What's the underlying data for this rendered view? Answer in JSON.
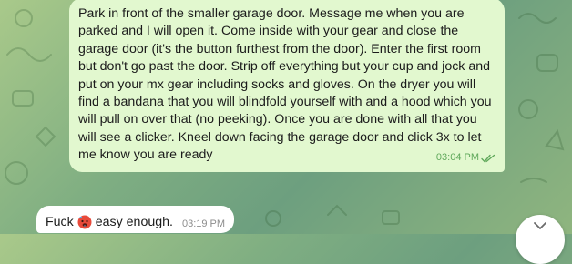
{
  "chat": {
    "outgoing": {
      "text": "Park in front of the smaller garage door.  Message me when you are parked and I will open it.  Come inside with your gear and close the garage door (it's the button furthest from the door).  Enter the first room but don't go past the door.  Strip off everything but your cup and jock and put on your mx gear including socks and gloves.  On the dryer you will find a bandana that you will blindfold yourself with and a hood which you will pull on over that (no peeking).  Once you are done with all that you will see a clicker.  Kneel down facing the garage door and click 3x to let me know you are ready",
      "time": "03:04 PM",
      "status_icon": "double-check-read"
    },
    "incoming": {
      "text_before": "Fuck",
      "emoji": "hot-face-emoji",
      "text_after": "easy enough.",
      "time": "03:19 PM"
    }
  },
  "scroll_button": {
    "icon": "chevron-down-icon"
  },
  "colors": {
    "outgoing_bubble": "#e2f8cf",
    "incoming_bubble": "#ffffff",
    "read_check": "#5fa85a"
  }
}
